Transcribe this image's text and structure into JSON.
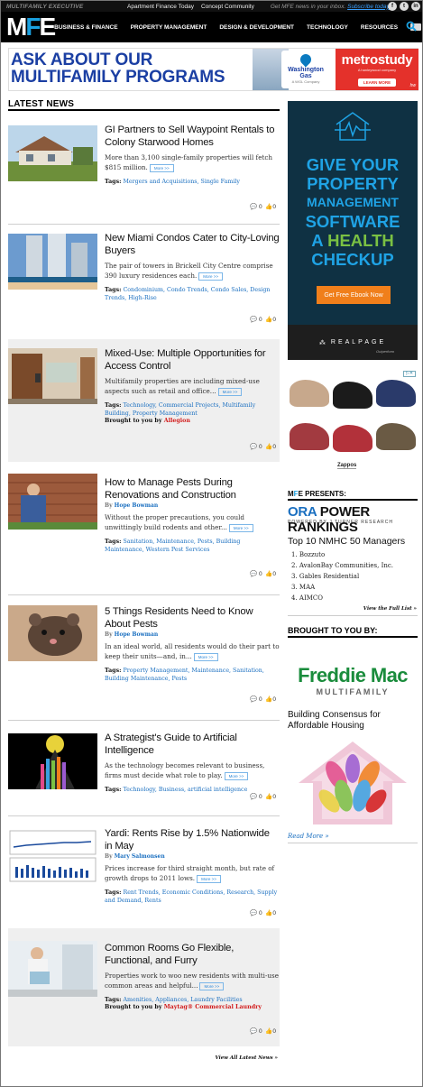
{
  "top_strip": {
    "brand": "MULTIFAMILY EXECUTIVE",
    "links": [
      "Apartment Finance Today",
      "Concept Community"
    ],
    "promo_text": "Get MFE news in your inbox.",
    "promo_link": "Subscribe today!"
  },
  "nav": {
    "logo_m": "M",
    "logo_f": "F",
    "logo_e": "E",
    "items": [
      "BUSINESS & FINANCE",
      "PROPERTY MANAGEMENT",
      "DESIGN & DEVELOPMENT",
      "TECHNOLOGY",
      "RESOURCES"
    ]
  },
  "banner_ad": {
    "line1": "ASK ABOUT OUR",
    "line2": "MULTIFAMILY PROGRAMS",
    "wg_name_1": "Washington",
    "wg_name_2": "Gas",
    "wg_small": "A WGL Company",
    "metro_brand": "metrostudy",
    "metro_sub": "A hanleywood company",
    "metro_button": "LEARN MORE",
    "metro_corner": "hw"
  },
  "latest": {
    "heading": "LATEST NEWS",
    "more_label": "More >>",
    "view_all": "View All Latest News »",
    "articles": [
      {
        "title": "GI Partners to Sell Waypoint Rentals to Colony Starwood Homes",
        "byline_prefix": "",
        "author": "",
        "summary": "More than 3,100 single-family properties will fetch $815 million.",
        "tags_label": "Tags:",
        "tags": "Mergers and Acquisitions, Single Family",
        "brought_prefix": "",
        "brought_sponsor": "",
        "comments": "0",
        "likes": "0"
      },
      {
        "title": "New Miami Condos Cater to City-Loving Buyers",
        "byline_prefix": "",
        "author": "",
        "summary": "The pair of towers in Brickell City Centre comprise 390 luxury residences each.",
        "tags_label": "Tags:",
        "tags": "Condominium, Condo Trends, Condo Sales, Design Trends, High-Rise",
        "brought_prefix": "",
        "brought_sponsor": "",
        "comments": "0",
        "likes": "0"
      },
      {
        "title": "Mixed-Use: Multiple Opportunities for Access Control",
        "byline_prefix": "",
        "author": "",
        "summary": "Multifamily properties are including mixed-use aspects such as retail and office...",
        "tags_label": "Tags:",
        "tags": "Technology, Commercial Projects, Multifamily Building, Property Management",
        "brought_prefix": "Brought to you by",
        "brought_sponsor": "Allegion",
        "comments": "0",
        "likes": "0"
      },
      {
        "title": "How to Manage Pests During Renovations and Construction",
        "byline_prefix": "By",
        "author": "Hope Bowman",
        "summary": "Without the proper precautions, you could unwittingly build rodents and other...",
        "tags_label": "Tags:",
        "tags": "Sanitation, Maintenance, Pests, Building Maintenance, Western Pest Services",
        "brought_prefix": "",
        "brought_sponsor": "",
        "comments": "0",
        "likes": "0"
      },
      {
        "title": "5 Things Residents Need to Know About Pests",
        "byline_prefix": "By",
        "author": "Hope Bowman",
        "summary": "In an ideal world, all residents would do their part to keep their units—and, in...",
        "tags_label": "Tags:",
        "tags": "Property Management, Maintenance, Sanitation, Building Maintenance, Pests",
        "brought_prefix": "",
        "brought_sponsor": "",
        "comments": "0",
        "likes": "0"
      },
      {
        "title": "A Strategist's Guide to Artificial Intelligence",
        "byline_prefix": "",
        "author": "",
        "summary": "As the technology becomes relevant to business, firms must decide what role to play.",
        "tags_label": "Tags:",
        "tags": "Technology, Business, artificial intelligence",
        "brought_prefix": "",
        "brought_sponsor": "",
        "comments": "0",
        "likes": "0"
      },
      {
        "title": "Yardi: Rents Rise by 1.5% Nationwide in May",
        "byline_prefix": "By",
        "author": "Mary Salmonsen",
        "summary": "Prices increase for third straight month, but rate of growth drops to 2011 lows.",
        "tags_label": "Tags:",
        "tags": "Rent Trends, Economic Conditions, Research, Supply and Demand, Rents",
        "brought_prefix": "",
        "brought_sponsor": "",
        "comments": "0",
        "likes": "0"
      },
      {
        "title": "Common Rooms Go Flexible, Functional, and Furry",
        "byline_prefix": "",
        "author": "",
        "summary": "Properties work to woo new residents with multi-use common areas and helpful...",
        "tags_label": "Tags:",
        "tags": "Amenities, Appliances, Laundry Facilities",
        "brought_prefix": "Brought to you by",
        "brought_sponsor": "Maytag® Commercial Laundry",
        "comments": "0",
        "likes": "0"
      }
    ]
  },
  "sidebar": {
    "ad_tall": {
      "line1": "GIVE YOUR",
      "line2": "PROPERTY",
      "line3": "MANAGEMENT",
      "line4": "SOFTWARE",
      "line5_a": "A ",
      "line5_b": "HEALTH",
      "line6": "CHECKUP",
      "cta": "Get Free Ebook Now",
      "brand": "REALPAGE",
      "tagline": "Outperform"
    },
    "shoes_ad": {
      "brand": "Zappos"
    },
    "presents": {
      "heading_m": "M",
      "heading_f": "F",
      "heading_e": "E",
      "heading_rest": " PRESENTS:",
      "ora_o": "ORA",
      "ora_rest": " POWER RANKINGS",
      "ora_sub": "POWERED BY J TURNER RESEARCH",
      "rank_title": "Top 10 NMHC 50 Managers",
      "rank_items": [
        "1. Bozzuto",
        "2. AvalonBay Communities, Inc.",
        "3. Gables Residential",
        "3. MAA",
        "4. AIMCO"
      ],
      "full_list": "View the Full List »"
    },
    "brought": {
      "heading": "BROUGHT TO YOU BY:",
      "fm_title": "Freddie Mac",
      "fm_sub": "MULTIFAMILY",
      "consensus": "Building Consensus for Affordable Housing",
      "read_more": "Read More »"
    }
  },
  "colors": {
    "accent_blue": "#1aa0e0",
    "link_blue": "#1a6fc0",
    "ad_navy": "#0f3143",
    "cta_orange": "#f07f1b",
    "freddie_green": "#1a8c3c"
  }
}
